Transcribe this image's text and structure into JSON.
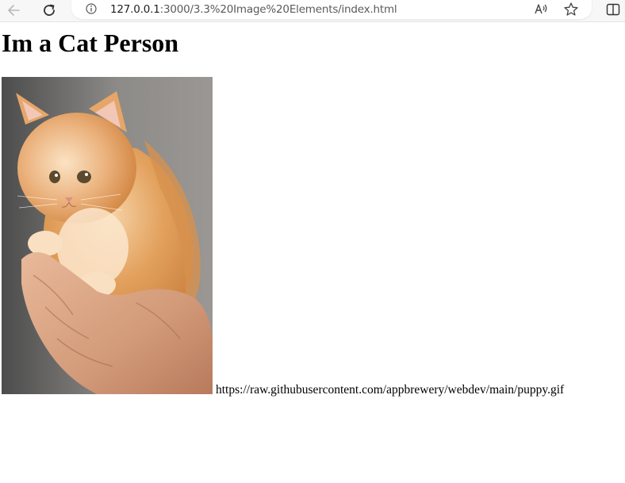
{
  "browser": {
    "url_host": "127.0.0.1",
    "url_path": ":3000/3.3%20Image%20Elements/index.html",
    "back_icon": "arrow-left-icon",
    "reload_icon": "reload-icon",
    "info_icon": "info-icon",
    "read_aloud_icon": "read-aloud-icon",
    "favorite_icon": "star-icon",
    "split_screen_icon": "split-screen-icon"
  },
  "page": {
    "heading": "Im a Cat Person",
    "image_subject": "orange kitten held in human hands",
    "broken_image_text": "https://raw.githubusercontent.com/appbrewery/webdev/main/puppy.gif"
  }
}
